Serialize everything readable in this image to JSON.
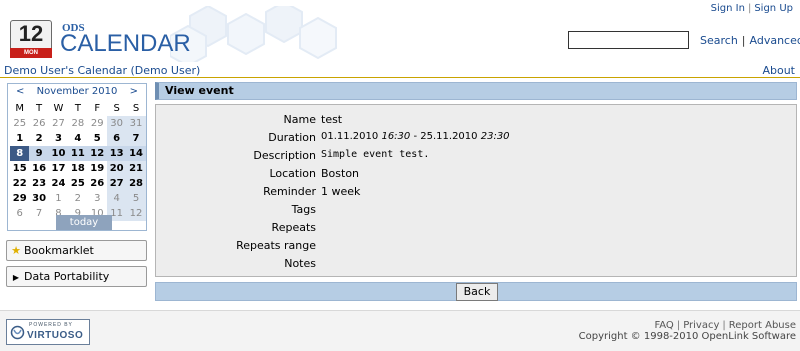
{
  "header": {
    "calendar_icon_number": "12",
    "calendar_icon_month": "MON",
    "app_small": "ODS",
    "app_big": "CALENDAR",
    "sign_in": "Sign In",
    "sign_up": "Sign Up",
    "search_value": "",
    "search_label": "Search",
    "advanced_label": "Advanced"
  },
  "breadcrumb": {
    "left": "Demo User's Calendar (Demo User)",
    "about": "About"
  },
  "minical": {
    "prev": "<",
    "next": ">",
    "month_title": "November 2010",
    "dows": [
      "M",
      "T",
      "W",
      "T",
      "F",
      "S",
      "S"
    ],
    "weeks": [
      [
        "25",
        "26",
        "27",
        "28",
        "29",
        "30",
        "31"
      ],
      [
        "1",
        "2",
        "3",
        "4",
        "5",
        "6",
        "7"
      ],
      [
        "8",
        "9",
        "10",
        "11",
        "12",
        "13",
        "14"
      ],
      [
        "15",
        "16",
        "17",
        "18",
        "19",
        "20",
        "21"
      ],
      [
        "22",
        "23",
        "24",
        "25",
        "26",
        "27",
        "28"
      ],
      [
        "29",
        "30",
        "1",
        "2",
        "3",
        "4",
        "5"
      ],
      [
        "6",
        "7",
        "8",
        "9",
        "10",
        "11",
        "12"
      ]
    ],
    "today_label": "today"
  },
  "sidebar": {
    "bookmarklet": "Bookmarklet",
    "data_portability": "Data Portability"
  },
  "view": {
    "title": "View event",
    "labels": {
      "name": "Name",
      "duration": "Duration",
      "description": "Description",
      "location": "Location",
      "reminder": "Reminder",
      "tags": "Tags",
      "repeats": "Repeats",
      "repeats_range": "Repeats range",
      "notes": "Notes"
    },
    "values": {
      "name": "test",
      "duration_start_date": "01.11.2010",
      "duration_start_time": "16:30",
      "duration_sep": "-",
      "duration_end_date": "25.11.2010",
      "duration_end_time": "23:30",
      "description": "Simple event test.",
      "location": "Boston",
      "reminder": "1 week",
      "tags": "",
      "repeats": "",
      "repeats_range": "",
      "notes": ""
    },
    "back_label": "Back"
  },
  "footer": {
    "powered_by": "POWERED BY",
    "virtuoso": "VIRTUOSO",
    "faq": "FAQ",
    "privacy": "Privacy",
    "report_abuse": "Report Abuse",
    "copyright": "Copyright © 1998-2010 OpenLink Software"
  },
  "colors": {
    "link": "#1a4b8f",
    "brand_blue": "#2a5fa5",
    "panel_blue": "#b6cde4",
    "selected_day": "#3c5a86",
    "accent_line": "#c9a300"
  }
}
